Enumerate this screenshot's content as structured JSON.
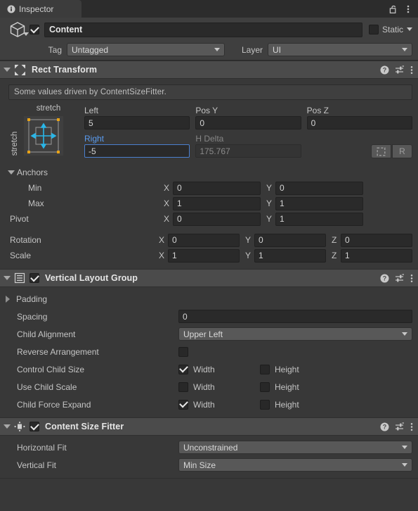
{
  "window": {
    "tab_label": "Inspector",
    "tab_icon": "info-icon",
    "lock_icon": "padlock-unlocked-icon",
    "menu_icon": "kebab-menu-icon"
  },
  "gameobject": {
    "icon": "cube-prefab-icon",
    "enabled": true,
    "name": "Content",
    "static_label": "Static",
    "static_checked": false,
    "tag_label": "Tag",
    "tag_value": "Untagged",
    "layer_label": "Layer",
    "layer_value": "UI"
  },
  "components": [
    {
      "id": "rect-transform",
      "title": "Rect Transform",
      "icon": "rect-transform-icon",
      "expanded": true,
      "has_enable_toggle": false,
      "help_icon": "help-icon",
      "preset_icon": "preset-settings-icon",
      "menu_icon": "kebab-menu-icon"
    },
    {
      "id": "vertical-layout-group",
      "title": "Vertical Layout Group",
      "icon": "vertical-layout-group-icon",
      "expanded": true,
      "has_enable_toggle": true,
      "enabled": true,
      "help_icon": "help-icon",
      "preset_icon": "preset-settings-icon",
      "menu_icon": "kebab-menu-icon"
    },
    {
      "id": "content-size-fitter",
      "title": "Content Size Fitter",
      "icon": "content-size-fitter-icon",
      "expanded": true,
      "has_enable_toggle": true,
      "enabled": true,
      "help_icon": "help-icon",
      "preset_icon": "preset-settings-icon",
      "menu_icon": "kebab-menu-icon"
    }
  ],
  "rect_transform": {
    "helpbox": "Some values driven by ContentSizeFitter.",
    "anchor_preset_top": "stretch",
    "anchor_preset_side": "stretch",
    "blueprint_button": "blueprint-mode-icon",
    "raw_button": "R",
    "fields": {
      "left_label": "Left",
      "left_value": "5",
      "posy_label": "Pos Y",
      "posy_value": "0",
      "posz_label": "Pos Z",
      "posz_value": "0",
      "right_label": "Right",
      "right_value": "-5",
      "hdelta_label": "H Delta",
      "hdelta_value": "175.767"
    },
    "anchors_label": "Anchors",
    "min_label": "Min",
    "min_x": "0",
    "min_y": "0",
    "max_label": "Max",
    "max_x": "1",
    "max_y": "1",
    "pivot_label": "Pivot",
    "pivot_x": "0",
    "pivot_y": "1",
    "rotation_label": "Rotation",
    "rotation_x": "0",
    "rotation_y": "0",
    "rotation_z": "0",
    "scale_label": "Scale",
    "scale_x": "1",
    "scale_y": "1",
    "scale_z": "1",
    "axis_x": "X",
    "axis_y": "Y",
    "axis_z": "Z"
  },
  "vertical_layout_group": {
    "padding_label": "Padding",
    "padding_expanded": false,
    "spacing_label": "Spacing",
    "spacing_value": "0",
    "child_alignment_label": "Child Alignment",
    "child_alignment_value": "Upper Left",
    "reverse_arrangement_label": "Reverse Arrangement",
    "reverse_arrangement_checked": false,
    "control_child_size_label": "Control Child Size",
    "control_child_size_width_checked": true,
    "control_child_size_height_checked": false,
    "use_child_scale_label": "Use Child Scale",
    "use_child_scale_width_checked": false,
    "use_child_scale_height_checked": false,
    "child_force_expand_label": "Child Force Expand",
    "child_force_expand_width_checked": true,
    "child_force_expand_height_checked": false,
    "width_label": "Width",
    "height_label": "Height"
  },
  "content_size_fitter": {
    "horizontal_fit_label": "Horizontal Fit",
    "horizontal_fit_value": "Unconstrained",
    "vertical_fit_label": "Vertical Fit",
    "vertical_fit_value": "Min Size"
  },
  "colors": {
    "panel_bg": "#383838",
    "header_bg": "#4b4b4b",
    "field_bg": "#2a2a2a",
    "dropdown_bg": "#585858",
    "accent_blue": "#5a9cf0",
    "anchor_orange": "#e8a317",
    "anchor_cyan": "#29b6e8",
    "text": "#c4c4c4"
  }
}
